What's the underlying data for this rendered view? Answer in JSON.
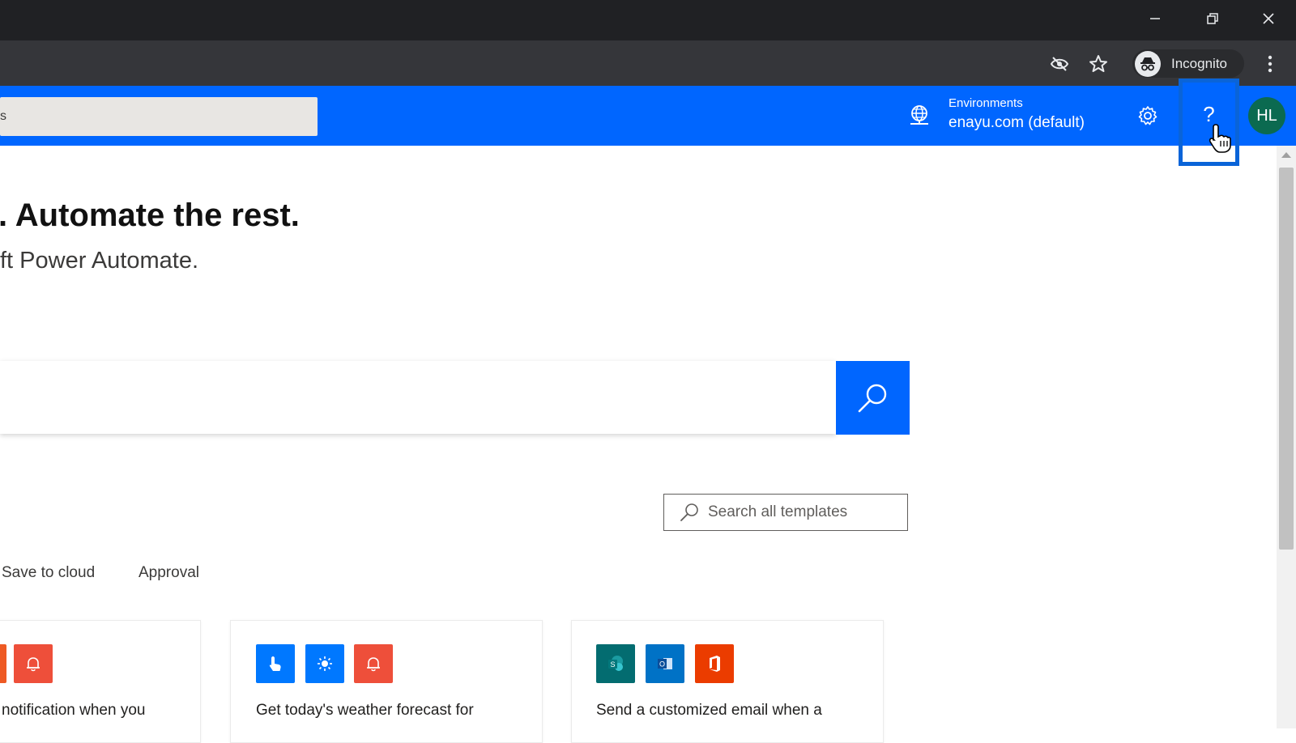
{
  "browser": {
    "profile_label": "Incognito",
    "icons": [
      "minimize-icon",
      "restore-icon",
      "close-icon",
      "eye-off-icon",
      "star-icon",
      "incognito-icon",
      "kebab-menu-icon"
    ]
  },
  "header": {
    "search_text": "s",
    "environment_label": "Environments",
    "environment_value": "enayu.com (default)",
    "help_label": "?",
    "avatar_initials": "HL",
    "accent_color": "#0066ff"
  },
  "hero": {
    "title": ". Automate the rest.",
    "subtitle": "ft Power Automate."
  },
  "templates": {
    "search_placeholder": "Search all templates",
    "tabs": [
      "Save to cloud",
      "Approval"
    ],
    "cards": [
      {
        "text": "notification when you"
      },
      {
        "text": "Get today's weather forecast for"
      },
      {
        "text": "Send a customized email when a"
      }
    ]
  }
}
